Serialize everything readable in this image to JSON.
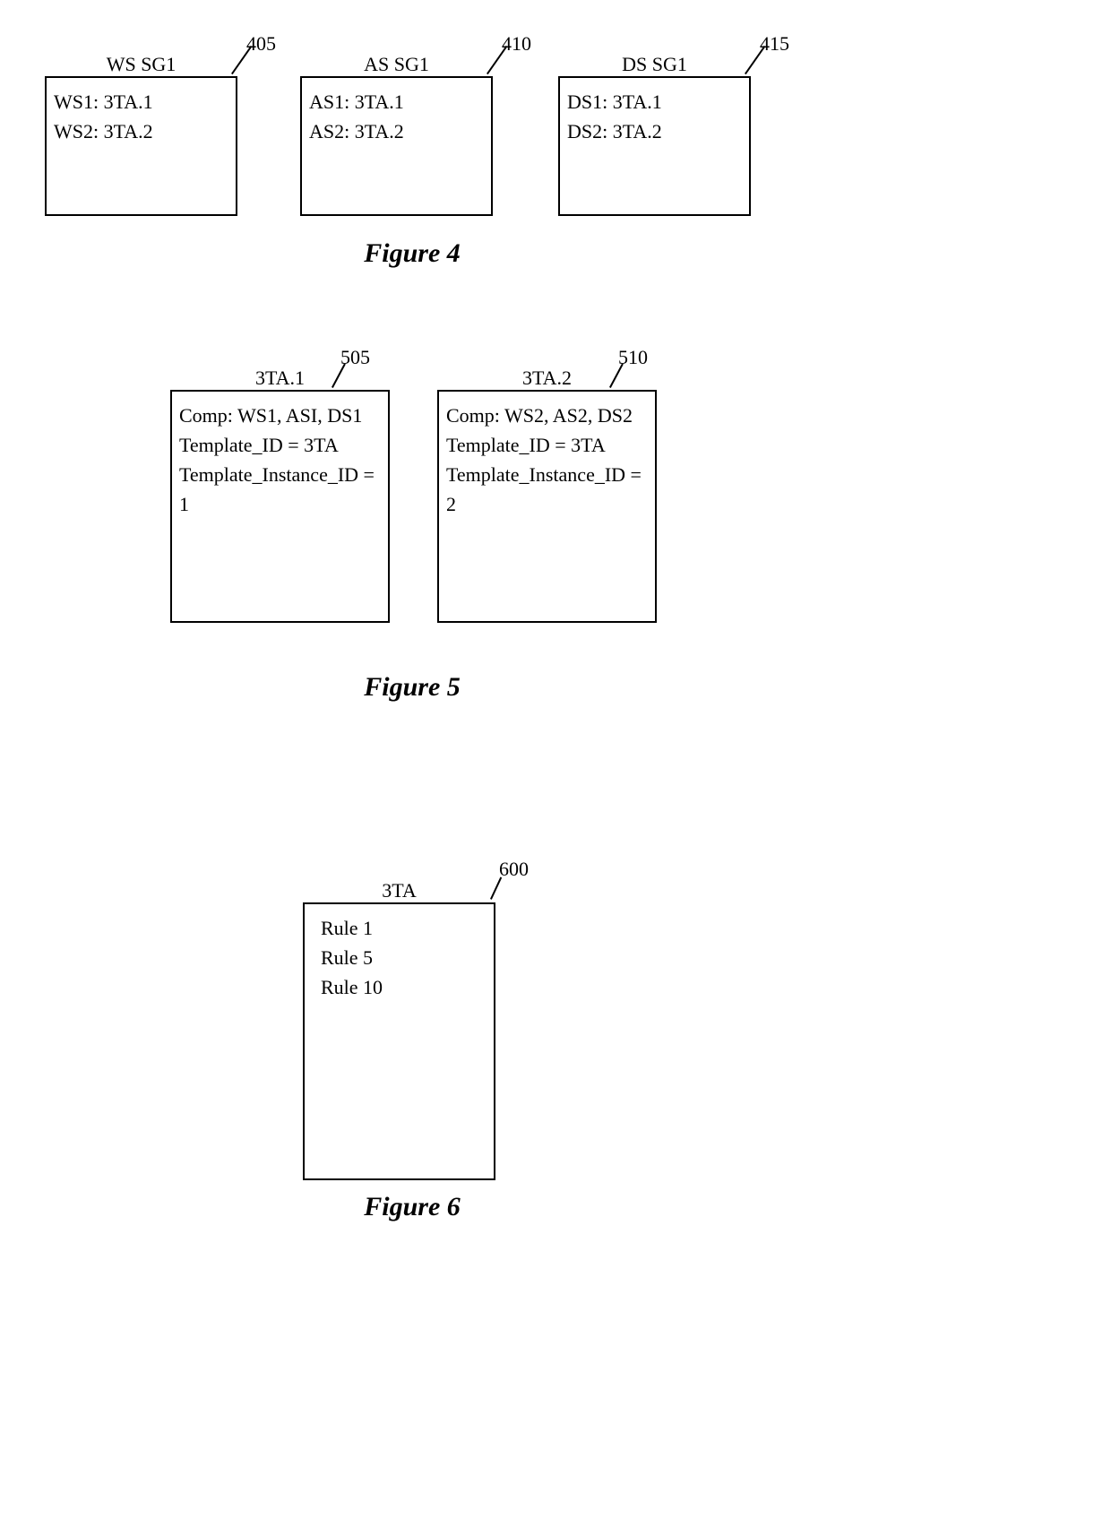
{
  "figure4": {
    "caption": "Figure 4",
    "boxes": [
      {
        "title": "WS SG1",
        "ref": "405",
        "lines": [
          "WS1: 3TA.1",
          "WS2: 3TA.2"
        ]
      },
      {
        "title": "AS SG1",
        "ref": "410",
        "lines": [
          "AS1: 3TA.1",
          "AS2: 3TA.2"
        ]
      },
      {
        "title": "DS SG1",
        "ref": "415",
        "lines": [
          "DS1: 3TA.1",
          "DS2: 3TA.2"
        ]
      }
    ]
  },
  "figure5": {
    "caption": "Figure 5",
    "boxes": [
      {
        "title": "3TA.1",
        "ref": "505",
        "lines": [
          "Comp: WS1, ASI, DS1",
          "Template_ID = 3TA",
          "Template_Instance_ID = 1"
        ]
      },
      {
        "title": "3TA.2",
        "ref": "510",
        "lines": [
          "Comp: WS2, AS2, DS2",
          "Template_ID = 3TA",
          "Template_Instance_ID = 2"
        ]
      }
    ]
  },
  "figure6": {
    "caption": "Figure 6",
    "boxes": [
      {
        "title": "3TA",
        "ref": "600",
        "lines": [
          "Rule 1",
          "Rule 5",
          "Rule 10"
        ]
      }
    ]
  }
}
